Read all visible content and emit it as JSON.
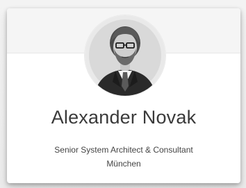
{
  "profile": {
    "name": "Alexander Novak",
    "role": "Senior System Architect & Consultant",
    "location": "München"
  },
  "avatar": {
    "icon": "person-photo"
  },
  "colors": {
    "card_background": "#ffffff",
    "header_background": "#f5f5f5",
    "text": "#3a3a3a"
  }
}
